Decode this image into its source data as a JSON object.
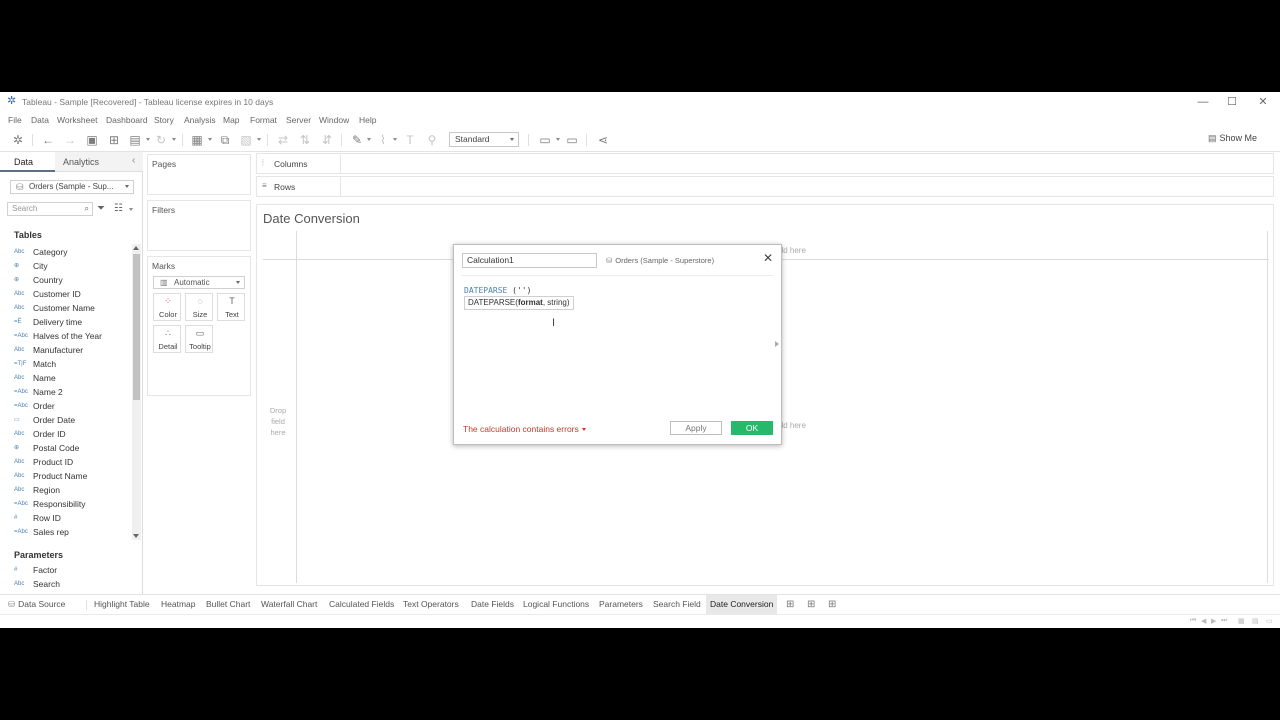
{
  "window": {
    "title": "Tableau - Sample [Recovered] - Tableau license expires in 10 days",
    "minimize": "—",
    "maximize": "☐",
    "close": "✕"
  },
  "menu": [
    "File",
    "Data",
    "Worksheet",
    "Dashboard",
    "Story",
    "Analysis",
    "Map",
    "Format",
    "Server",
    "Window",
    "Help"
  ],
  "toolbar": {
    "fit_select": "Standard",
    "show_me": "Show Me"
  },
  "data_pane": {
    "tabs": [
      "Data",
      "Analytics"
    ],
    "collapse_icon": "‹",
    "data_source": "Orders (Sample - Sup...",
    "search_placeholder": "Search",
    "tables_heading": "Tables",
    "fields": [
      {
        "icon": "Abc",
        "label": "Category"
      },
      {
        "icon": "⊕",
        "label": "City"
      },
      {
        "icon": "⊕",
        "label": "Country"
      },
      {
        "icon": "Abc",
        "label": "Customer ID"
      },
      {
        "icon": "Abc",
        "label": "Customer Name"
      },
      {
        "icon": "=Ë",
        "label": "Delivery time"
      },
      {
        "icon": "=Abc",
        "label": "Halves of the Year"
      },
      {
        "icon": "Abc",
        "label": "Manufacturer"
      },
      {
        "icon": "=T|F",
        "label": "Match"
      },
      {
        "icon": "Abc",
        "label": "Name"
      },
      {
        "icon": "=Abc",
        "label": "Name 2"
      },
      {
        "icon": "=Abc",
        "label": "Order"
      },
      {
        "icon": "▭",
        "label": "Order Date"
      },
      {
        "icon": "Abc",
        "label": "Order ID"
      },
      {
        "icon": "⊕",
        "label": "Postal Code"
      },
      {
        "icon": "Abc",
        "label": "Product ID"
      },
      {
        "icon": "Abc",
        "label": "Product Name"
      },
      {
        "icon": "Abc",
        "label": "Region"
      },
      {
        "icon": "=Abc",
        "label": "Responsibility"
      },
      {
        "icon": "#",
        "label": "Row ID"
      },
      {
        "icon": "=Abc",
        "label": "Sales rep"
      }
    ],
    "parameters_heading": "Parameters",
    "parameters": [
      {
        "icon": "#",
        "label": "Factor"
      },
      {
        "icon": "Abc",
        "label": "Search"
      }
    ]
  },
  "cards": {
    "pages": "Pages",
    "filters": "Filters",
    "marks": "Marks",
    "mark_type": "Automatic",
    "mark_buttons": [
      {
        "icon": "⁘",
        "label": "Color"
      },
      {
        "icon": "◌",
        "label": "Size"
      },
      {
        "icon": "T",
        "label": "Text"
      },
      {
        "icon": "∴",
        "label": "Detail"
      },
      {
        "icon": "▭",
        "label": "Tooltip"
      }
    ]
  },
  "shelves": {
    "columns": "Columns",
    "rows": "Rows"
  },
  "sheet": {
    "title": "Date Conversion",
    "drop_field": "Drop field here",
    "drop_field_top": "eld here",
    "drop_field_right": "eld here"
  },
  "calc_dialog": {
    "name": "Calculation1",
    "data_source": "Orders (Sample - Superstore)",
    "code_fn": "DATEPARSE",
    "code_args": " ('')",
    "hint_fn": "DATEPARSE(",
    "hint_bold": "format",
    "hint_rest": ", string)",
    "errors": "The calculation contains errors",
    "apply": "Apply",
    "ok": "OK"
  },
  "sheet_tabs": [
    "Data Source",
    "Highlight Table",
    "Heatmap",
    "Bullet Chart",
    "Waterfall Chart",
    "Calculated Fields",
    "Text Operators",
    "Date Fields",
    "Logical Functions",
    "Parameters",
    "Search Field",
    "Date Conversion"
  ],
  "active_tab": "Date Conversion",
  "colors": {
    "ok_button": "#27b86b",
    "error_text": "#c0392b",
    "field_icon": "#4a7fb0",
    "formula_function": "#4a82b8"
  }
}
